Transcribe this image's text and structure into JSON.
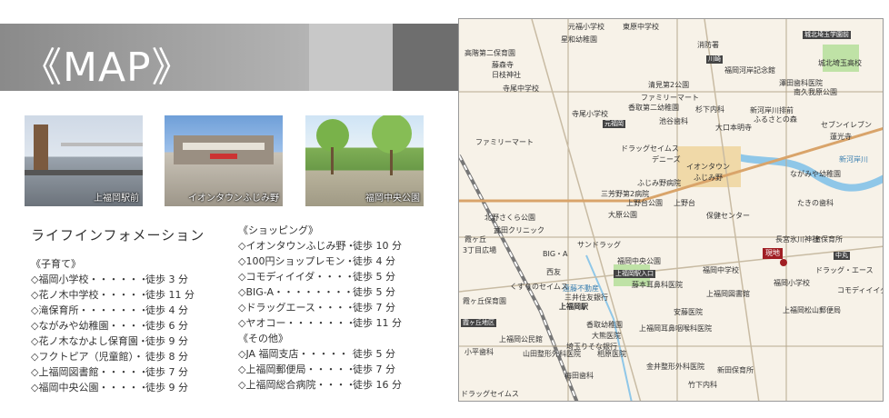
{
  "header": {
    "title": "《MAP》"
  },
  "photos": [
    {
      "caption": "上福岡駅前"
    },
    {
      "caption": "イオンタウンふじみ野"
    },
    {
      "caption": "福岡中央公園"
    }
  ],
  "info": {
    "heading": "ライフインフォメーション",
    "left_sections": [
      {
        "category": "《子育て》",
        "items": [
          {
            "name": "◇福岡小学校・・・・・・・",
            "time": "徒歩 3 分"
          },
          {
            "name": "◇花ノ木中学校・・・・・・",
            "time": "徒歩 11 分"
          },
          {
            "name": "◇滝保育所・・・・・・・・",
            "time": "徒歩 4 分"
          },
          {
            "name": "◇ながみや幼稚園・・・・・",
            "time": "徒歩 6 分"
          },
          {
            "name": "◇花ノ木なかよし保育園・・",
            "time": "徒歩 9 分"
          },
          {
            "name": "◇フクトピア（児童館）・・",
            "time": "徒歩 8 分"
          },
          {
            "name": "◇上福岡図書館・・・・・・",
            "time": "徒歩 7 分"
          },
          {
            "name": "◇福岡中央公園・・・・・・",
            "time": "徒歩 9 分"
          }
        ]
      }
    ],
    "right_sections": [
      {
        "category": "《ショッピング》",
        "items": [
          {
            "name": "◇イオンタウンふじみ野・・",
            "time": "徒歩 10 分"
          },
          {
            "name": "◇100円ショップレモン・・",
            "time": "徒歩 4 分"
          },
          {
            "name": "◇コモディイイダ・・・・・",
            "time": "徒歩 5 分"
          },
          {
            "name": "◇BIG-A・・・・・・・・・",
            "time": "徒歩 5 分"
          },
          {
            "name": "◇ドラッグエース・・・・・",
            "time": "徒歩 7 分"
          },
          {
            "name": "◇ヤオコー・・・・・・・・",
            "time": "徒歩 11 分"
          }
        ]
      },
      {
        "category": "《その他》",
        "items": [
          {
            "name": "◇JA 福岡支店・・・・・・",
            "time": "徒歩 5 分"
          },
          {
            "name": "◇上福岡郵便局・・・・・・",
            "time": "徒歩 7 分"
          },
          {
            "name": "◇上福岡総合病院・・・・・",
            "time": "徒歩 16 分"
          }
        ]
      }
    ]
  },
  "map": {
    "labels": [
      "元福小学校",
      "東原中学校",
      "星和幼稚園",
      "高階第二保育園",
      "藤森寺",
      "日枝神社",
      "城北埼玉学園前",
      "城北埼玉高校",
      "消防署",
      "川崎",
      "福岡河岸記念館",
      "寺尾中学校",
      "清見第2公園",
      "ファミリーマート",
      "香取第二幼稚園",
      "杉下内科",
      "澤田歯科医院",
      "南久我原公園",
      "寺尾小学校",
      "元福岡",
      "池谷歯科",
      "大口本明寺",
      "新河岸川排前",
      "ふるさとの森",
      "セブンイレブン",
      "蓮光寺",
      "ファミリーマート",
      "ドラッグセイムス",
      "イオンタウン",
      "ふじみ野",
      "デニーズ",
      "ふじみ野病院",
      "三芳野第2病院",
      "上野台",
      "大原公園",
      "上野台公園",
      "保健センター",
      "ながみや幼稚園",
      "たきの歯科",
      "新河岸川",
      "北野さくら公園",
      "武田クリニック",
      "長宮氷川神社",
      "滝保育所",
      "現地",
      "中丸",
      "ドラッグ・エース",
      "霞ヶ丘",
      "3丁目広場",
      "BIG・A",
      "西友",
      "サンドラッグ",
      "福岡中央公園",
      "上福岡駅入口",
      "遠藤不動産",
      "藤本耳鼻科医院",
      "福岡中学校",
      "上福岡図書館",
      "福岡小学校",
      "コモディイイダ",
      "上福岡駅",
      "三井住友銀行",
      "くすりのセイムス",
      "霞ヶ丘保育園",
      "霞ヶ丘地区",
      "安藤医院",
      "上福岡松山郵便局",
      "香取幼稚園",
      "大熊医院",
      "上福岡耳鼻咽喉科医院",
      "上福岡公民館",
      "山田整形外科医院",
      "埼玉りそな銀行",
      "相原医院",
      "小平歯科",
      "金井整形外科医院",
      "新田保育所",
      "梅田歯科",
      "竹下内科",
      "ドラッグセイムス",
      "城北",
      "霞ヶ丘"
    ]
  },
  "colors": {
    "header_gray": "#9e9e9e",
    "map_bg": "#f7f2e8",
    "here_red": "#a01e23",
    "park_green": "#8bc46a",
    "river_blue": "#8fc7e8"
  }
}
